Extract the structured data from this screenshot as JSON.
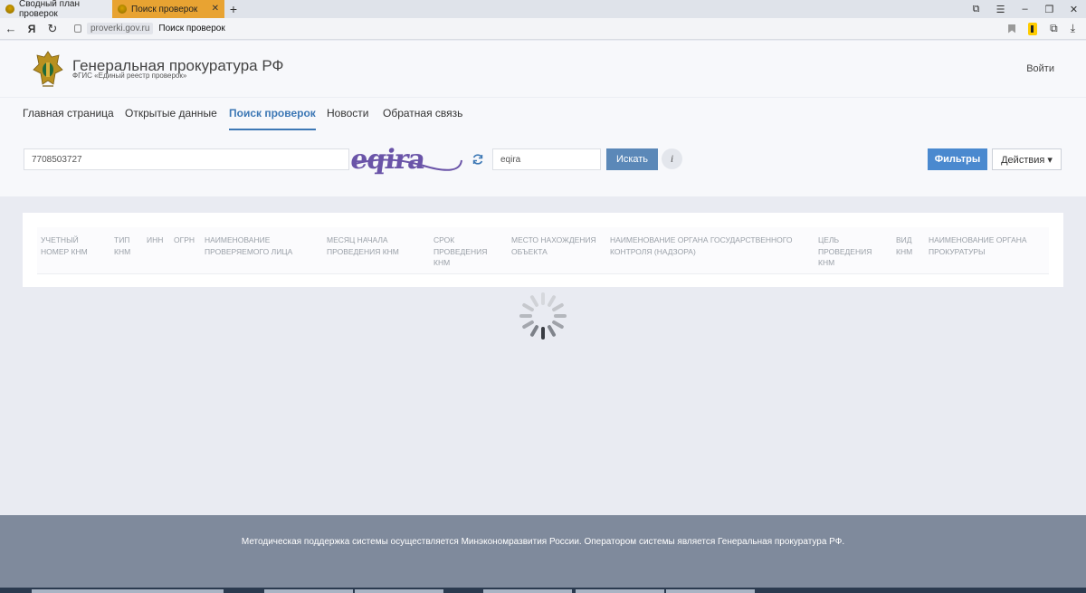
{
  "browser": {
    "tabs": [
      {
        "label": "Сводный план проверок",
        "active": false
      },
      {
        "label": "Поиск проверок",
        "active": true
      }
    ],
    "url_domain": "proverki.gov.ru",
    "url_title": "Поиск проверок",
    "yandex_logo": "Я"
  },
  "header": {
    "title": "Генеральная прокуратура РФ",
    "subtitle": "ФГИС «Единый реестр проверок»",
    "login": "Войти"
  },
  "nav": {
    "items": [
      {
        "label": "Главная страница",
        "active": false
      },
      {
        "label": "Открытые данные",
        "active": false
      },
      {
        "label": "Поиск проверок",
        "active": true
      },
      {
        "label": "Новости",
        "active": false
      },
      {
        "label": "Обратная связь",
        "active": false
      }
    ]
  },
  "search": {
    "query_value": "7708503727",
    "captcha_text": "eqira",
    "captcha_input_value": "eqira",
    "search_button": "Искать",
    "info_label": "i",
    "filters_button": "Фильтры",
    "actions_button": "Действия ▾"
  },
  "table": {
    "columns": [
      "Учетный номер КНМ",
      "Тип КНМ",
      "ИНН",
      "ОГРН",
      "Наименование проверяемого лица",
      "Месяц начала проведения КНМ",
      "Срок проведения КНМ",
      "Место нахождения объекта",
      "Наименование органа государственного контроля (надзора)",
      "Цель проведения КНМ",
      "Вид КНМ",
      "Наименование органа прокуратуры"
    ]
  },
  "footer": {
    "text": "Методическая поддержка системы осуществляется Минэкономразвития России. Оператором системы является Генеральная прокуратура РФ."
  },
  "colors": {
    "accent": "#4a89cf",
    "active_tab": "#e8a332",
    "footer_bg": "#7f8a9c"
  }
}
